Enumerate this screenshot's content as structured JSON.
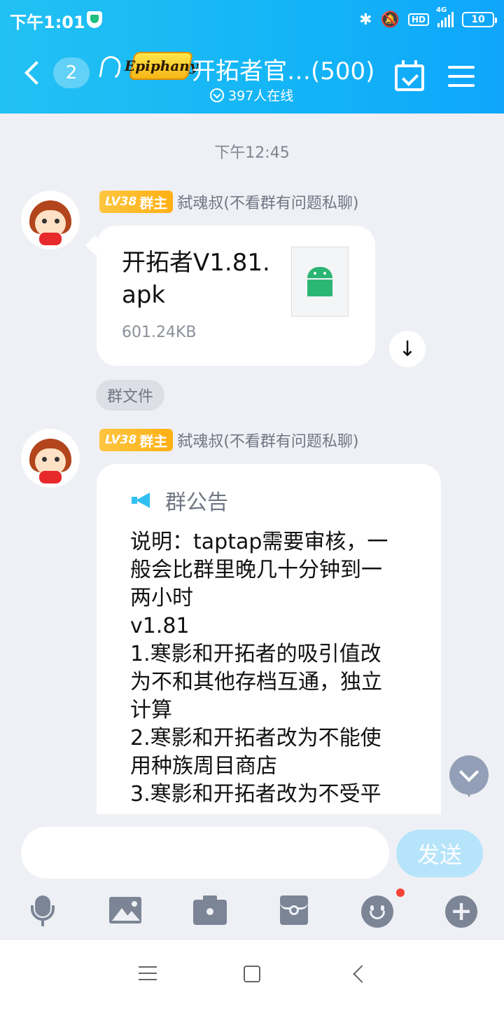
{
  "status_bar": {
    "time": "下午1:01",
    "hd": "HD",
    "network": "4G",
    "battery": "10"
  },
  "header": {
    "back_count": "2",
    "logo_text": "Epiphany",
    "title": "开拓者官…(500)",
    "online": "397人在线"
  },
  "chat": {
    "timestamp": "下午12:45",
    "messages": [
      {
        "sender_level": "LV38",
        "sender_role": "群主",
        "sender_name": "弑魂叔(不看群有问题私聊)",
        "file_name": "开拓者V1.81.apk",
        "file_size": "601.24KB",
        "tag": "群文件"
      },
      {
        "sender_level": "LV38",
        "sender_role": "群主",
        "sender_name": "弑魂叔(不看群有问题私聊)",
        "notice_title": "群公告",
        "notice_lines": [
          "说明：taptap需要审核，一",
          "般会比群里晚几十分钟到一",
          "两小时",
          "v1.81",
          "1.寒影和开拓者的吸引值改",
          "为不和其他存档互通，独立",
          "计算",
          "2.寒影和开拓者改为不能使",
          "用种族周目商店",
          "3.寒影和开拓者改为不受平"
        ]
      }
    ]
  },
  "input": {
    "value": "",
    "send_label": "发送"
  },
  "icons": {
    "toolbar": [
      "mic-icon",
      "image-icon",
      "camera-icon",
      "red-packet-icon",
      "emoji-icon",
      "plus-icon"
    ]
  },
  "colors": {
    "header": "#13b4f7",
    "badge": "#ffb014",
    "send": "#b6e4fb",
    "notification_dot": "#f44336"
  }
}
